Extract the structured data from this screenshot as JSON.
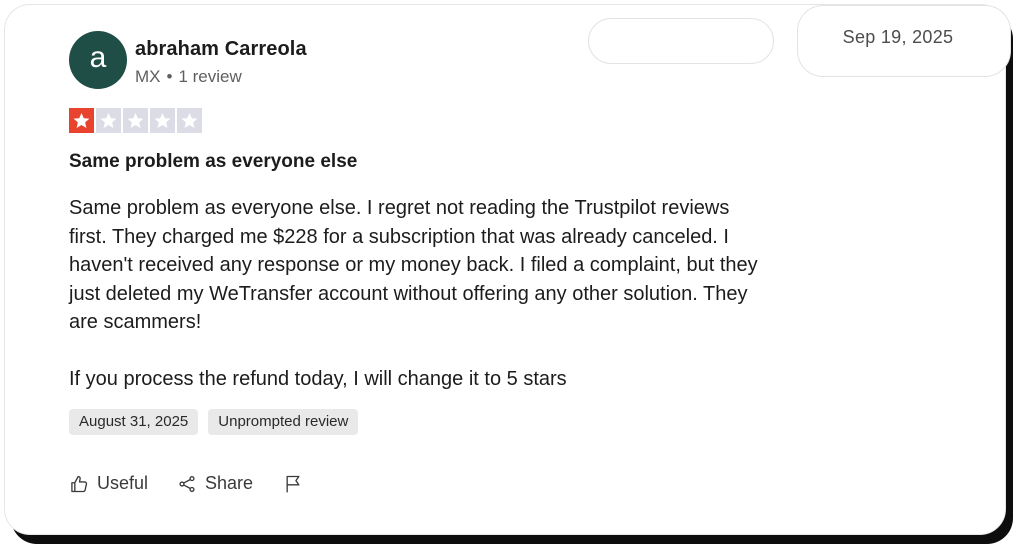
{
  "reviewer": {
    "avatar_letter": "a",
    "avatar_color": "#1e4e45",
    "name": "abraham Carreola",
    "country": "MX",
    "separator": "•",
    "review_count": "1 review"
  },
  "header": {
    "date": "Sep 19, 2025"
  },
  "rating": {
    "value": 1,
    "max": 5,
    "filled_color": "#e8432e",
    "empty_color": "#dcdce6"
  },
  "review": {
    "title": "Same problem as everyone else",
    "body_paragraph_1": "Same problem as everyone else. I regret not reading the Trustpilot reviews first. They charged me $228 for a subscription that was already canceled. I haven't received any response or my money back. I filed a complaint, but they just deleted my WeTransfer account without offering any other solution. They are scammers!",
    "body_paragraph_2": "If you process the refund today, I will change it to 5 stars"
  },
  "tags": {
    "experience_date": "August 31, 2025",
    "review_type": "Unprompted review"
  },
  "actions": {
    "useful_label": "Useful",
    "useful_icon": "thumbs-up-icon",
    "share_label": "Share",
    "share_icon": "share-icon",
    "flag_icon": "flag-icon"
  }
}
